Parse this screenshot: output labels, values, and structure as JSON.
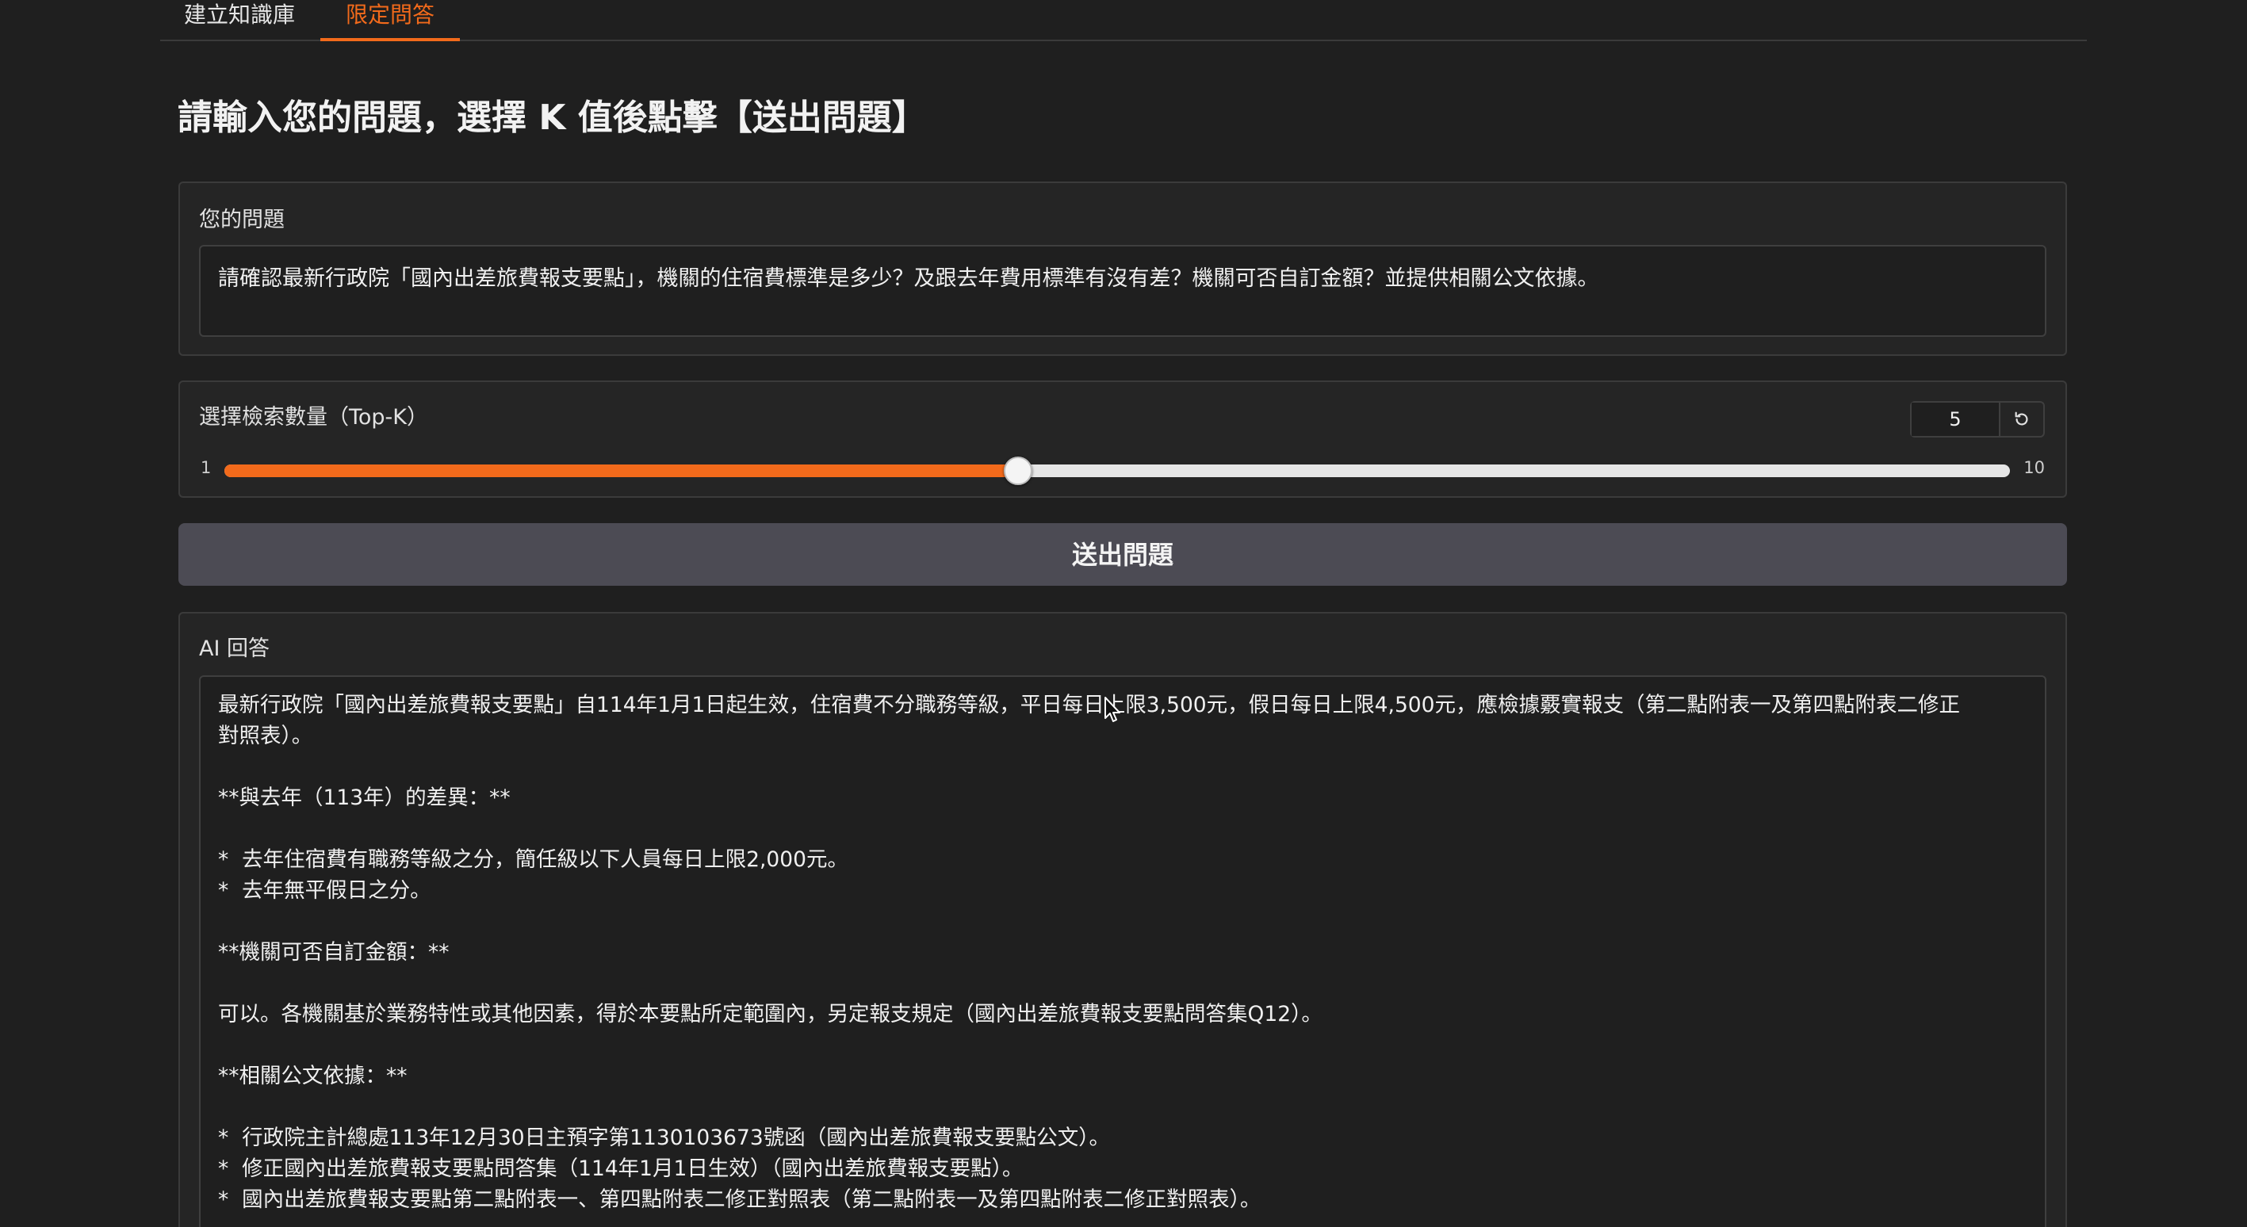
{
  "tabs": [
    {
      "label": "建立知識庫",
      "active": false
    },
    {
      "label": "限定問答",
      "active": true
    }
  ],
  "heading": "請輸入您的問題，選擇 K 值後點擊【送出問題】",
  "question": {
    "label": "您的問題",
    "value": "請確認最新行政院「國內出差旅費報支要點」，機關的住宿費標準是多少？及跟去年費用標準有沒有差？機關可否自訂金額？並提供相關公文依據。"
  },
  "topk": {
    "label": "選擇檢索數量（Top-K）",
    "value": "5",
    "min": "1",
    "max": "10",
    "current": 5,
    "range": [
      1,
      10
    ],
    "reset_icon": "reset-icon"
  },
  "submit_label": "送出問題",
  "answer": {
    "label": "AI 回答",
    "lines": [
      "最新行政院「國內出差旅費報支要點」自114年1月1日起生效，住宿費不分職務等級，平日每日上限3,500元，假日每日上限4,500元，應檢據覈實報支（第二點附表一及第四點附表二修正",
      "對照表）。",
      "",
      "**與去年（113年）的差異：**",
      "",
      "*  去年住宿費有職務等級之分，簡任級以下人員每日上限2,000元。",
      "*  去年無平假日之分。",
      "",
      "**機關可否自訂金額：**",
      "",
      "可以。各機關基於業務特性或其他因素，得於本要點所定範圍內，另定報支規定（國內出差旅費報支要點問答集Q12）。",
      "",
      "**相關公文依據：**",
      "",
      "*  行政院主計總處113年12月30日主預字第1130103673號函（國內出差旅費報支要點公文）。",
      "*  修正國內出差旅費報支要點問答集（114年1月1日生效）（國內出差旅費報支要點）。",
      "*  國內出差旅費報支要點第二點附表一、第四點附表二修正對照表（第二點附表一及第四點附表二修正對照表）。"
    ]
  },
  "colors": {
    "accent": "#f26a1b",
    "background": "#1f1f1f",
    "panel": "#252525",
    "button": "#4c4b54"
  }
}
